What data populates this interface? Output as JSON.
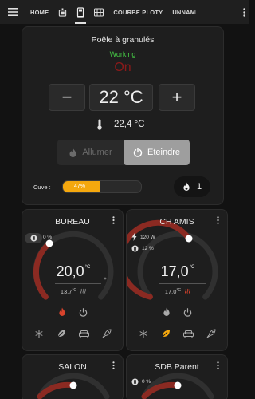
{
  "tabs": [
    {
      "label": "HOME"
    },
    {
      "label": "",
      "icon": "stove-icon"
    },
    {
      "label": "",
      "icon": "gas-station-icon"
    },
    {
      "label": "",
      "icon": "radiator-icon"
    },
    {
      "label": "COURBE PLOTY"
    },
    {
      "label": "UNNAMED"
    }
  ],
  "poele": {
    "title": "Poêle à granulés",
    "status": "Working",
    "state": "On",
    "minus": "−",
    "plus": "+",
    "target": "22 °C",
    "current": "22,4 °C",
    "btn_allumer": "Allumer",
    "btn_eteindre": "Eteindre",
    "cuve_label": "Cuve :",
    "cuve_pct_text": "47%",
    "cuve_level": 0.47,
    "flame_count": "1",
    "colors": {
      "status": "#46c946",
      "state": "#8b1a1a",
      "cuve": "#f5a80e"
    }
  },
  "thermostats": [
    {
      "name": "BUREAU",
      "target_val": "20,0",
      "unit": "°C",
      "current_val": "13,7",
      "heat_pct": "0 %",
      "power": "",
      "humidity_pct": "",
      "active_mode": "heat",
      "active_preset": ""
    },
    {
      "name": "CH AMIS",
      "target_val": "17,0",
      "unit": "°C",
      "current_val": "17,0",
      "heat_pct": "",
      "power": "120 W",
      "humidity_pct": "12 %",
      "active_mode": "",
      "active_preset": "eco"
    },
    {
      "name": "SALON",
      "target_val": "",
      "unit": "",
      "current_val": "",
      "heat_pct": "",
      "power": "",
      "humidity_pct": "",
      "active_mode": "",
      "active_preset": ""
    },
    {
      "name": "SDB Parent",
      "target_val": "",
      "unit": "",
      "current_val": "",
      "heat_pct": "0 %",
      "power": "",
      "humidity_pct": "",
      "active_mode": "",
      "active_preset": ""
    }
  ]
}
